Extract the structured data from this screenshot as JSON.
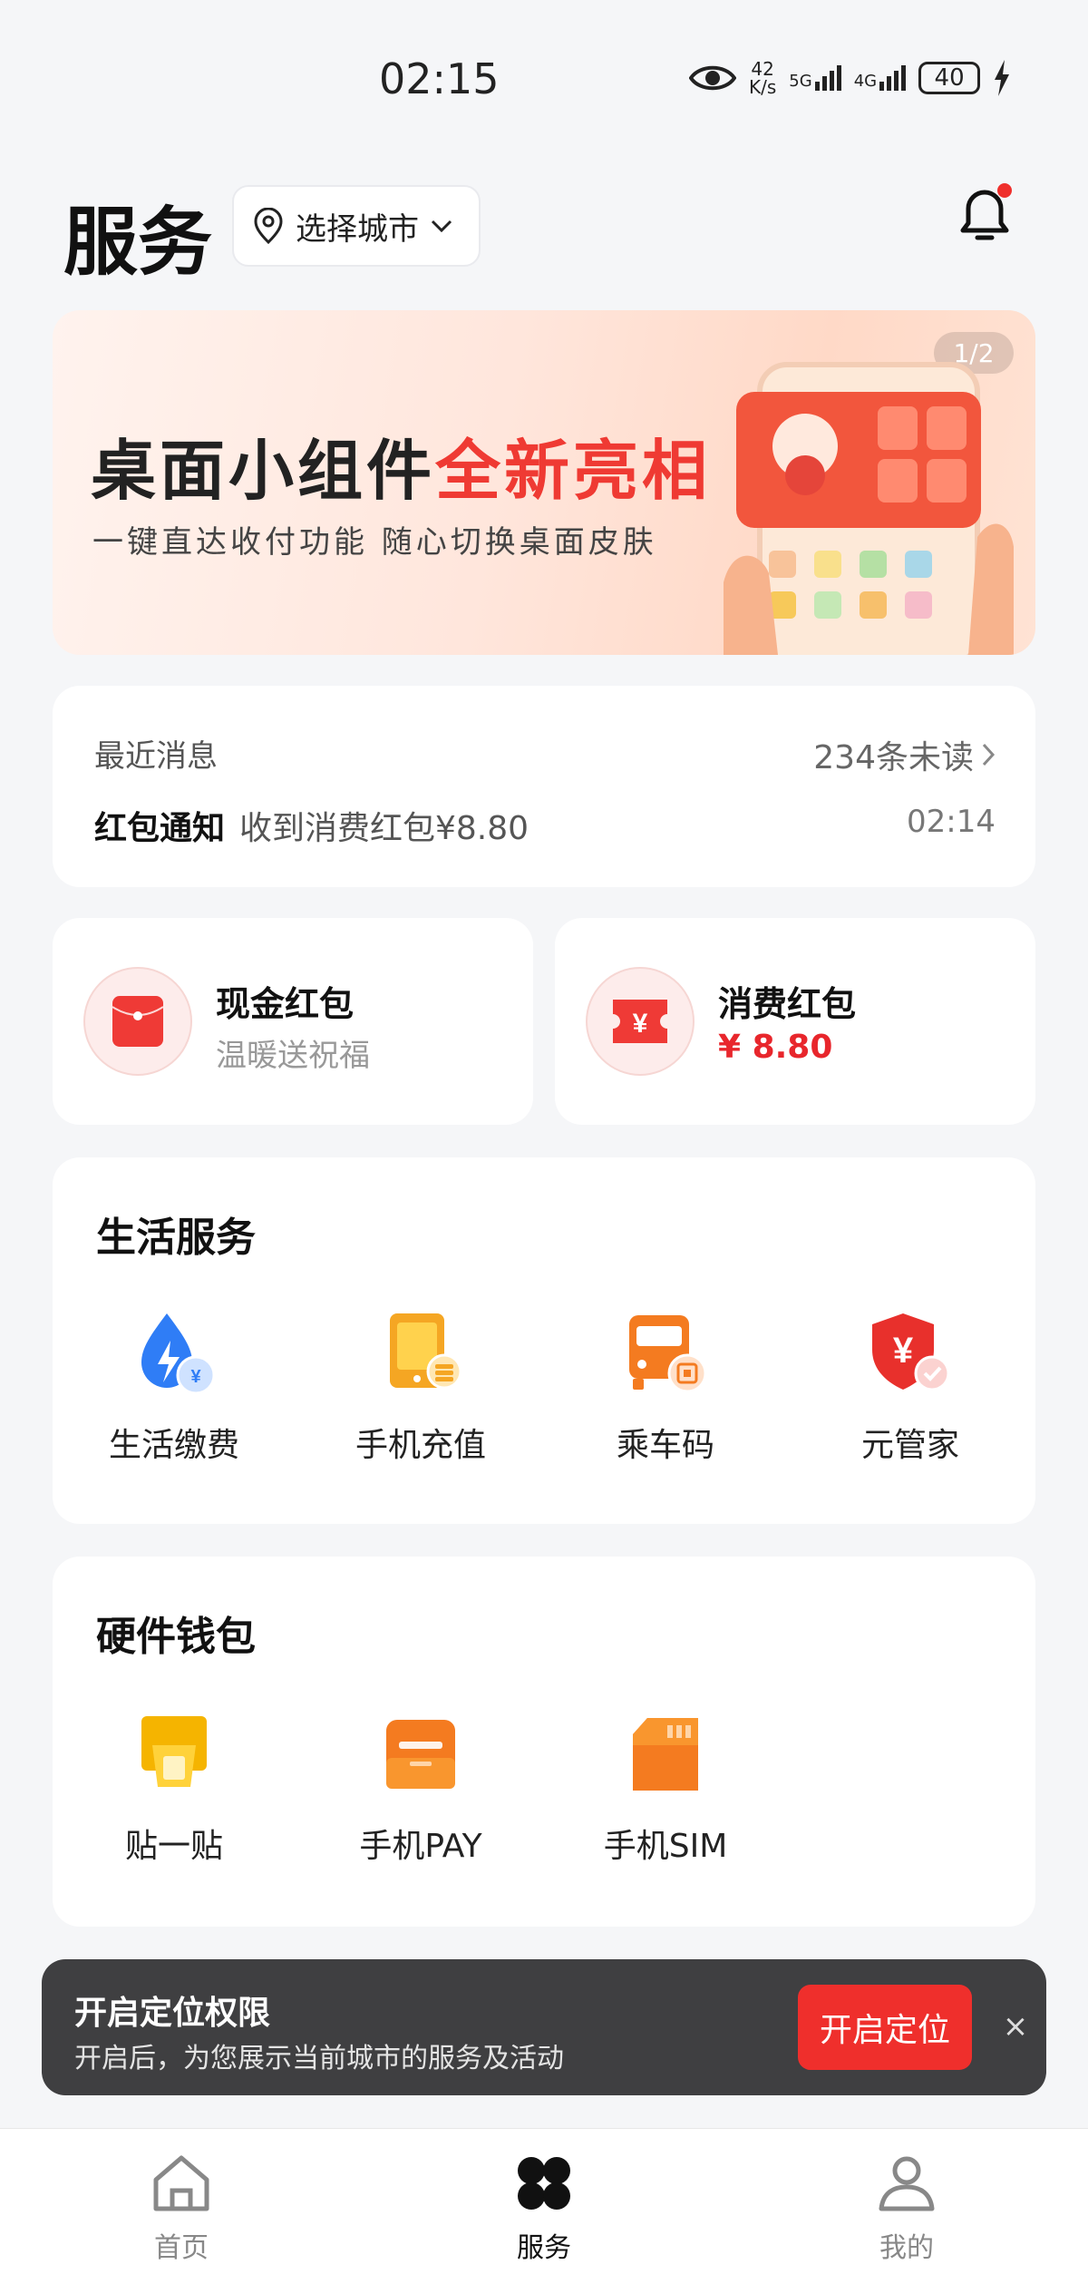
{
  "status_bar": {
    "time": "02:15",
    "speed_top": "42",
    "speed_bottom": "K/s",
    "net1": "5G",
    "net2": "4G",
    "battery": "40"
  },
  "header": {
    "title": "服务",
    "city": "选择城市"
  },
  "banner": {
    "title_part1": "桌面小组件",
    "title_part2": "全新亮相",
    "subtitle": "一键直达收付功能  随心切换桌面皮肤",
    "page": "1/2"
  },
  "messages": {
    "label": "最近消息",
    "unread": "234条未读",
    "item_title": "红包通知",
    "item_text": "收到消费红包¥8.80",
    "item_time": "02:14"
  },
  "red_packets": [
    {
      "title": "现金红包",
      "sub": "温暖送祝福"
    },
    {
      "title": "消费红包",
      "amount": "¥ 8.80"
    }
  ],
  "life_services": {
    "title": "生活服务",
    "items": [
      {
        "label": "生活缴费",
        "icon": "water-bolt-icon"
      },
      {
        "label": "手机充值",
        "icon": "phone-topup-icon"
      },
      {
        "label": "乘车码",
        "icon": "bus-code-icon"
      },
      {
        "label": "元管家",
        "icon": "shield-yuan-icon"
      }
    ]
  },
  "hardware_wallet": {
    "title": "硬件钱包",
    "items": [
      {
        "label": "贴一贴",
        "icon": "tap-phone-icon"
      },
      {
        "label": "手机PAY",
        "icon": "card-pay-icon"
      },
      {
        "label": "手机SIM",
        "icon": "sim-card-icon"
      }
    ]
  },
  "toast": {
    "title": "开启定位权限",
    "subtitle": "开启后，为您展示当前城市的服务及活动",
    "button": "开启定位",
    "close": "×"
  },
  "bottom_nav": [
    {
      "label": "首页"
    },
    {
      "label": "服务"
    },
    {
      "label": "我的"
    }
  ],
  "colors": {
    "accent_red": "#ef2f2c",
    "background": "#f5f6f8"
  }
}
